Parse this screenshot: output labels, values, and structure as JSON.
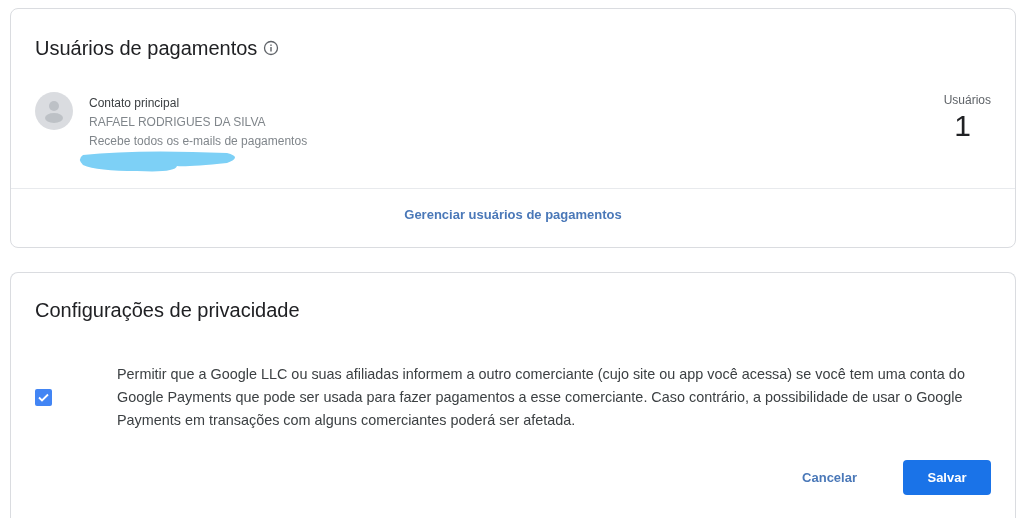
{
  "payment_users": {
    "title": "Usuários de pagamentos",
    "contact": {
      "label": "Contato principal",
      "name": "RAFAEL RODRIGUES DA SILVA",
      "note": "Recebe todos os e-mails de pagamentos"
    },
    "users_label": "Usuários",
    "users_count": "1",
    "manage_link": "Gerenciar usuários de pagamentos"
  },
  "privacy": {
    "title": "Configurações de privacidade",
    "consent": {
      "checked": true,
      "text": "Permitir que a Google LLC ou suas afiliadas informem a outro comerciante (cujo site ou app você acessa) se você tem uma conta do Google Payments que pode ser usada para fazer pagamentos a esse comerciante. Caso contrário, a possibilidade de usar o Google Payments em transações com alguns comerciantes poderá ser afetada."
    },
    "buttons": [
      {
        "label": "Cancelar",
        "kind": "text"
      },
      {
        "label": "Salvar",
        "kind": "primary"
      }
    ]
  }
}
